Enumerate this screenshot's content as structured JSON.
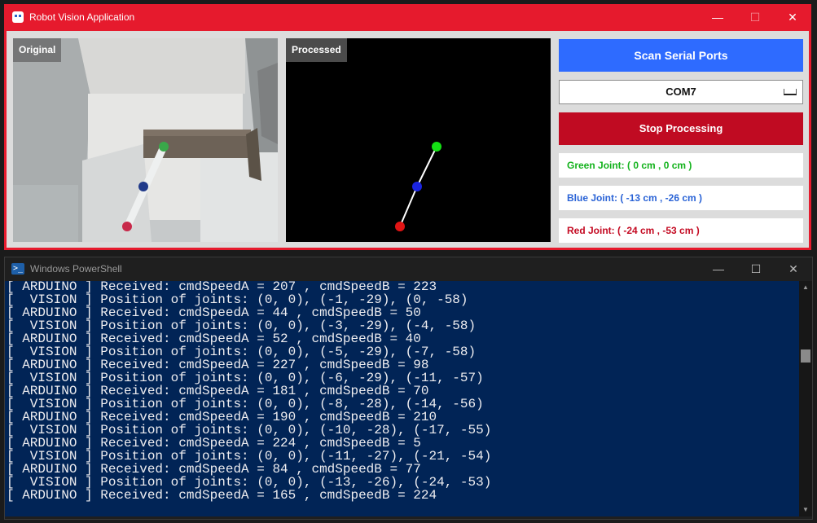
{
  "robot_window": {
    "title": "Robot Vision Application",
    "min_glyph": "—",
    "max_glyph": "☐",
    "close_glyph": "✕",
    "original_label": "Original",
    "processed_label": "Processed",
    "scan_button": "Scan Serial Ports",
    "port_selected": "COM7",
    "stop_button": "Stop Processing",
    "green_joint": "Green Joint: ( 0 cm , 0 cm )",
    "blue_joint": "Blue Joint: ( -13 cm , -26 cm )",
    "red_joint": "Red Joint: ( -24 cm , -53 cm )",
    "colors": {
      "accent": "#e61a2d",
      "scan_button": "#2e6bff",
      "stop_button": "#c00b22",
      "green": "#13b21c",
      "blue": "#2a63d6",
      "red": "#c40a22"
    }
  },
  "powershell": {
    "title": "Windows PowerShell",
    "icon_glyph": ">_",
    "min_glyph": "—",
    "max_glyph": "☐",
    "close_glyph": "✕",
    "background": "#012456",
    "lines": [
      "[ ARDUINO ] Received: cmdSpeedA = 207 , cmdSpeedB = 223",
      "[  VISION ] Position of joints: (0, 0), (-1, -29), (0, -58)",
      "[ ARDUINO ] Received: cmdSpeedA = 44 , cmdSpeedB = 50",
      "[  VISION ] Position of joints: (0, 0), (-3, -29), (-4, -58)",
      "[ ARDUINO ] Received: cmdSpeedA = 52 , cmdSpeedB = 40",
      "[  VISION ] Position of joints: (0, 0), (-5, -29), (-7, -58)",
      "[ ARDUINO ] Received: cmdSpeedA = 227 , cmdSpeedB = 98",
      "[  VISION ] Position of joints: (0, 0), (-6, -29), (-11, -57)",
      "[ ARDUINO ] Received: cmdSpeedA = 181 , cmdSpeedB = 70",
      "[  VISION ] Position of joints: (0, 0), (-8, -28), (-14, -56)",
      "[ ARDUINO ] Received: cmdSpeedA = 190 , cmdSpeedB = 210",
      "[  VISION ] Position of joints: (0, 0), (-10, -28), (-17, -55)",
      "[ ARDUINO ] Received: cmdSpeedA = 224 , cmdSpeedB = 5",
      "[  VISION ] Position of joints: (0, 0), (-11, -27), (-21, -54)",
      "[ ARDUINO ] Received: cmdSpeedA = 84 , cmdSpeedB = 77",
      "[  VISION ] Position of joints: (0, 0), (-13, -26), (-24, -53)",
      "[ ARDUINO ] Received: cmdSpeedA = 165 , cmdSpeedB = 224"
    ],
    "scroll_up_glyph": "▲",
    "scroll_down_glyph": "▼"
  }
}
